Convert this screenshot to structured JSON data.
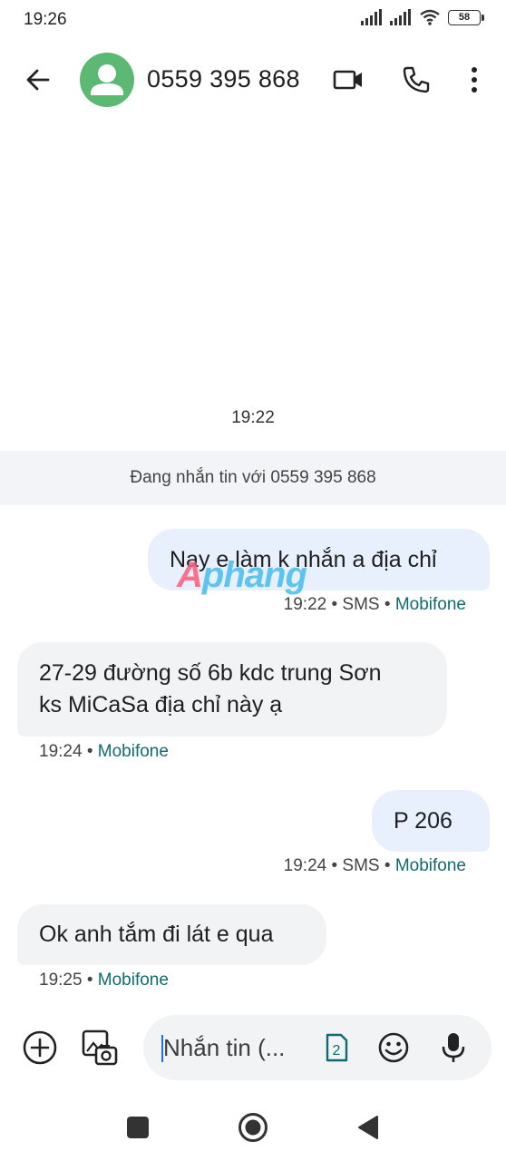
{
  "status_bar": {
    "time": "19:26",
    "battery": "58"
  },
  "header": {
    "contact": "0559 395 868"
  },
  "conversation": {
    "date_separator": "19:22",
    "banner": "Đang nhắn tin với 0559 395 868",
    "messages": [
      {
        "dir": "out",
        "text": "Nay e làm k nhắn a địa chỉ",
        "time": "19:22",
        "sms": "SMS",
        "carrier": "Mobifone"
      },
      {
        "dir": "in",
        "line1": "27-29 đường số 6b kdc trung Sơn",
        "line2": "ks MiCaSa địa chỉ này ạ",
        "time": "19:24",
        "carrier": "Mobifone"
      },
      {
        "dir": "out",
        "text": "P 206",
        "time": "19:24",
        "sms": "SMS",
        "carrier": "Mobifone"
      },
      {
        "dir": "in",
        "text": "Ok anh tắm đi lát e qua",
        "time": "19:25",
        "carrier": "Mobifone"
      }
    ],
    "separator_dot": "•"
  },
  "watermark": {
    "part1": "A",
    "part2": "phang"
  },
  "composer": {
    "placeholder": "Nhắn tin (...",
    "sim_slot": "2"
  },
  "colors": {
    "avatar": "#5bb974",
    "outgoing_bubble": "#e8f0fe",
    "incoming_bubble": "#f1f3f4",
    "carrier": "#0f6b6f",
    "caret": "#1a73e8"
  },
  "icons": [
    "back-arrow-icon",
    "person-icon",
    "video-call-icon",
    "phone-icon",
    "more-vert-icon",
    "add-circle-icon",
    "gallery-icon",
    "sim-card-icon",
    "emoji-icon",
    "mic-icon"
  ]
}
